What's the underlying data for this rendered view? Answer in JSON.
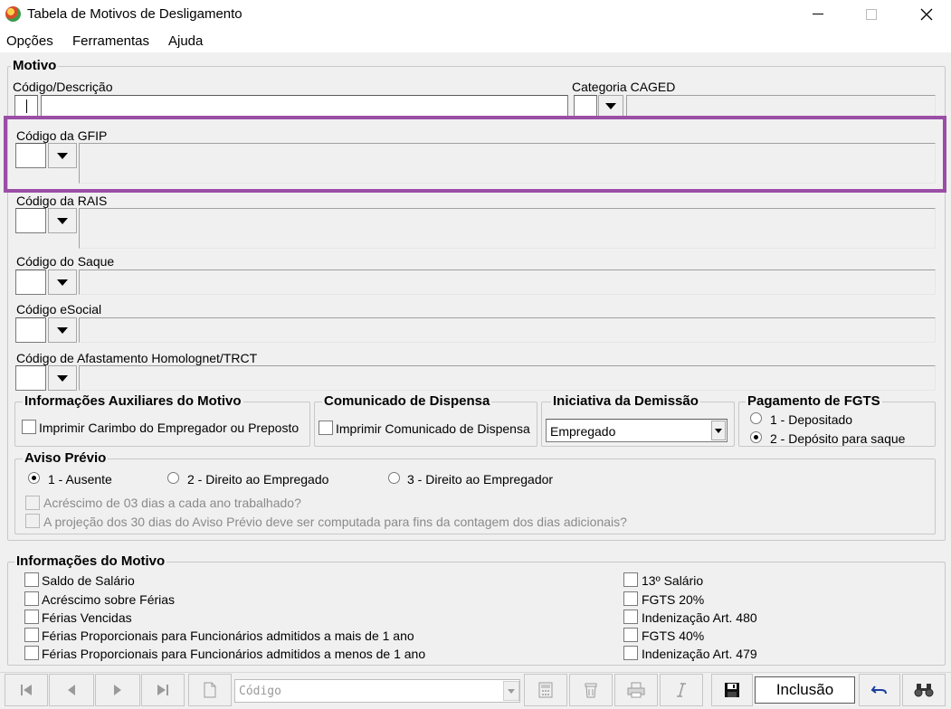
{
  "window": {
    "title": "Tabela de Motivos de Desligamento"
  },
  "menu": [
    "Opções",
    "Ferramentas",
    "Ajuda"
  ],
  "motivo": {
    "legend": "Motivo",
    "codigo_descricao_label": "Código/Descrição",
    "categoria_caged_label": "Categoria CAGED",
    "gfip_label": "Código da GFIP",
    "rais_label": "Código da RAIS",
    "saque_label": "Código do Saque",
    "esocial_label": "Código eSocial",
    "homolognet_label": "Código de Afastamento Homolognet/TRCT"
  },
  "info_aux": {
    "legend": "Informações Auxiliares do Motivo",
    "checkbox_label": "Imprimir Carimbo do Empregador ou Preposto"
  },
  "comunicado": {
    "legend": "Comunicado de Dispensa",
    "checkbox_label": "Imprimir Comunicado de Dispensa"
  },
  "iniciativa": {
    "legend": "Iniciativa da Demissão",
    "selected": "Empregado"
  },
  "fgts": {
    "legend": "Pagamento de FGTS",
    "options": [
      "1 - Depositado",
      "2 - Depósito para saque"
    ],
    "selected_index": 1
  },
  "aviso": {
    "legend": "Aviso Prévio",
    "options": [
      "1 - Ausente",
      "2 - Direito ao Empregado",
      "3 - Direito ao Empregador"
    ],
    "selected_index": 0,
    "check1": "Acréscimo de 03 dias a cada ano trabalhado?",
    "check2": "A projeção dos 30 dias do Aviso Prévio deve ser computada para fins da contagem dos dias adicionais?"
  },
  "info_motivo": {
    "legend": "Informações do Motivo",
    "left": [
      "Saldo de Salário",
      "Acréscimo sobre Férias",
      "Férias Vencidas",
      "Férias Proporcionais para Funcionários admitidos a mais de 1 ano",
      "Férias Proporcionais para Funcionários admitidos a menos de 1 ano"
    ],
    "right": [
      "13º Salário",
      "FGTS 20%",
      "Indenização Art. 480",
      "FGTS 40%",
      "Indenização Art. 479"
    ]
  },
  "toolbar": {
    "search_placeholder": "Código",
    "mode": "Inclusão"
  },
  "colors": {
    "highlight": "#9b4ea6"
  }
}
